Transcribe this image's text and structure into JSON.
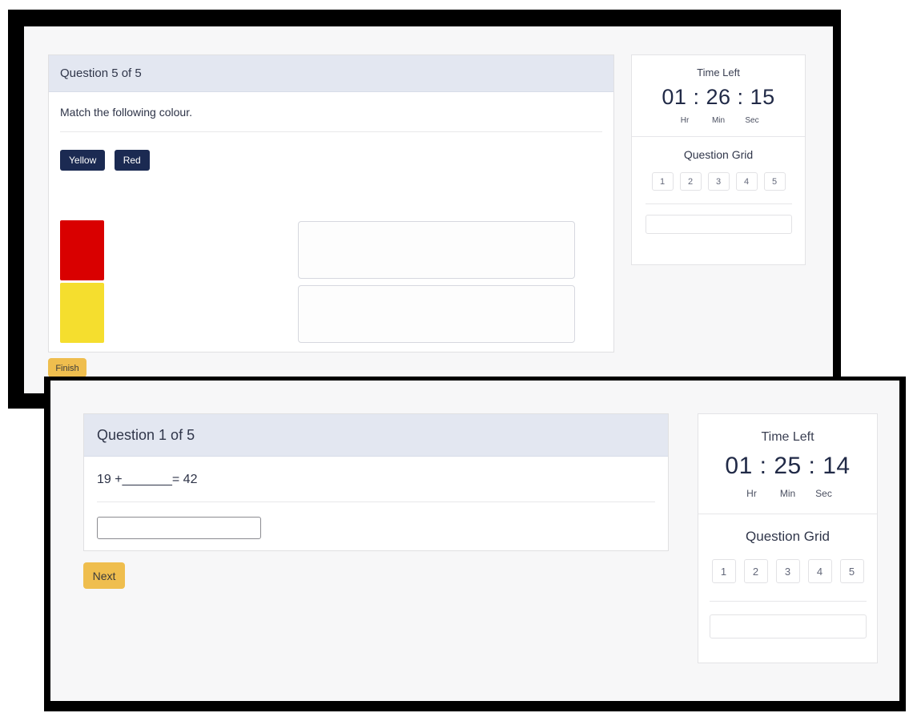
{
  "back_window": {
    "card": {
      "header_title": "Question 5 of 5",
      "question_text": "Match the following colour.",
      "option_tags": [
        {
          "label": "Yellow"
        },
        {
          "label": "Red"
        }
      ],
      "swatches": [
        {
          "name": "red-swatch",
          "color": "#D90000"
        },
        {
          "name": "yellow-swatch",
          "color": "#F5DE2E"
        }
      ],
      "dropzones": [
        {
          "value": ""
        },
        {
          "value": ""
        }
      ],
      "action_label": "Finish"
    },
    "panel": {
      "time_left_label": "Time Left",
      "hours": "01",
      "minutes": "26",
      "seconds": "15",
      "separator": ":",
      "unit_hr": "Hr",
      "unit_min": "Min",
      "unit_sec": "Sec",
      "question_grid_label": "Question Grid",
      "grid_items": [
        "1",
        "2",
        "3",
        "4",
        "5"
      ],
      "status_box_value": ""
    }
  },
  "front_window": {
    "card": {
      "header_title": "Question 1 of 5",
      "question_text": "19 +_______= 42",
      "answer_value": "",
      "answer_placeholder": "",
      "action_label": "Next"
    },
    "panel": {
      "time_left_label": "Time Left",
      "hours": "01",
      "minutes": "25",
      "seconds": "14",
      "separator": ":",
      "unit_hr": "Hr",
      "unit_min": "Min",
      "unit_sec": "Sec",
      "question_grid_label": "Question Grid",
      "grid_items": [
        "1",
        "2",
        "3",
        "4",
        "5"
      ],
      "status_box_value": ""
    }
  },
  "theme": {
    "header_bg": "#E3E7F1",
    "tag_bg": "#1B2A52",
    "action_bg": "#EFBE4E",
    "digits_color": "#212A47",
    "frame_color": "#000000",
    "page_bg": "#F7F7F8"
  }
}
